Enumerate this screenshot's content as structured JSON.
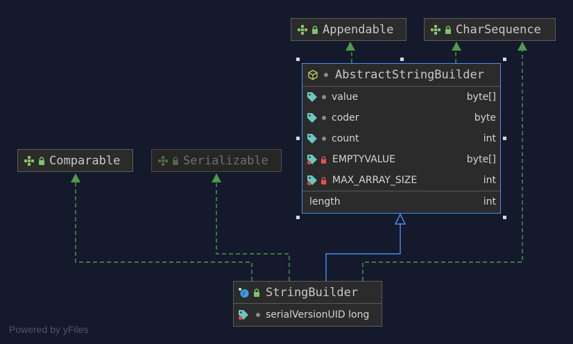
{
  "interfaces": {
    "appendable": {
      "name": "Appendable",
      "icon": "interface-icon"
    },
    "charsequence": {
      "name": "CharSequence",
      "icon": "interface-icon"
    },
    "comparable": {
      "name": "Comparable",
      "icon": "interface-icon"
    },
    "serializable": {
      "name": "Serializable",
      "icon": "interface-icon"
    }
  },
  "abstract_class": {
    "name": "AbstractStringBuilder",
    "icon": "abstract-class-icon",
    "fields": [
      {
        "name": "value",
        "type": "byte[]",
        "icon": "field-icon"
      },
      {
        "name": "coder",
        "type": "byte",
        "icon": "field-icon"
      },
      {
        "name": "count",
        "type": "int",
        "icon": "field-icon"
      },
      {
        "name": "EMPTYVALUE",
        "type": "byte[]",
        "icon": "static-final-field-icon"
      },
      {
        "name": "MAX_ARRAY_SIZE",
        "type": "int",
        "icon": "static-final-field-icon"
      }
    ],
    "properties": [
      {
        "name": "length",
        "type": "int"
      }
    ]
  },
  "class": {
    "name": "StringBuilder",
    "icon": "final-class-icon",
    "fields": [
      {
        "label": "serialVersionUID long",
        "icon": "static-final-field-icon"
      }
    ]
  },
  "footer": "Powered by yFiles",
  "colors": {
    "background": "#141a2b",
    "implements_edge": "#4f9a4c",
    "extends_edge": "#4a8ff0",
    "selection": "#4a8ff0"
  }
}
